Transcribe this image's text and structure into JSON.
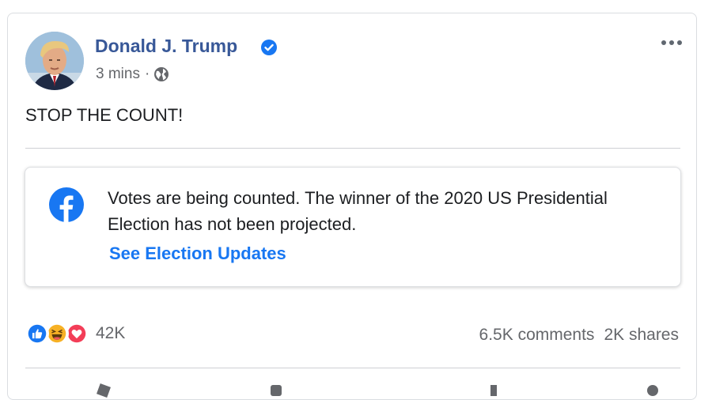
{
  "post": {
    "author": "Donald J. Trump",
    "time": "3 mins",
    "separator": "·",
    "text": "STOP THE COUNT!"
  },
  "notice": {
    "text": "Votes are being counted. The winner of the 2020 US Presidential Election has not been projected.",
    "link": "See Election Updates"
  },
  "reactions": {
    "icons": [
      "like-icon",
      "haha-icon",
      "love-icon"
    ],
    "count": "42K"
  },
  "engagement": {
    "comments": "6.5K comments",
    "shares": "2K shares"
  },
  "colors": {
    "author": "#385898",
    "link": "#1877f2",
    "verified": "#1877f2",
    "muted": "#65676b"
  }
}
